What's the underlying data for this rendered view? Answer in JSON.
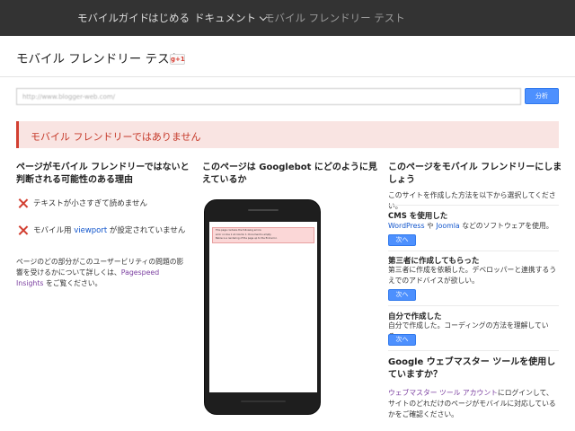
{
  "nav": {
    "items": [
      "モバイルガイド",
      "はじめる",
      "ドキュメント"
    ],
    "current": "モバイル フレンドリー テスト"
  },
  "header": {
    "title": "モバイル フレンドリー テスト",
    "gplus": "g+1"
  },
  "search": {
    "url_value": "http://www.blogger-web.com/",
    "button": "分析"
  },
  "result": {
    "message": "モバイル フレンドリーではありません"
  },
  "col1": {
    "heading": "ページがモバイル フレンドリーではないと判断される可能性のある理由",
    "issue1": "テキストが小さすぎて読めません",
    "issue2_prefix": "モバイル用 ",
    "issue2_link": "viewport",
    "issue2_suffix": " が設定されていません",
    "footer_prefix": "ページのどの部分がこのユーザービリティの問題の影響を受けるかについて詳しくは、",
    "footer_link": "Pagespeed Insights",
    "footer_suffix": " をご覧ください。"
  },
  "col2": {
    "heading_prefix": "このページは ",
    "heading_strong": "Googlebot",
    "heading_suffix": " にどのように見えているか",
    "screen_line1": "This page contains the following errors:",
    "screen_line2": "error on line 1 at column 1: Document is empty",
    "screen_line3": "Below is a rendering of the page up to the first error."
  },
  "col3": {
    "heading": "このページをモバイル フレンドリーにしましょう",
    "intro": "このサイトを作成した方法を以下から選択してください。",
    "cms_title": "CMS を使用した",
    "cms_link1": "WordPress",
    "cms_mid": " や ",
    "cms_link2": "Joomla",
    "cms_suffix": " などのソフトウェアを使用。",
    "next1": "次へ",
    "third_title": "第三者に作成してもらった",
    "third_desc": "第三者に作成を依頼した。デベロッパーと連携するうえでのアドバイスが欲しい。",
    "next2": "次へ",
    "self_title": "自分で作成した",
    "self_desc": "自分で作成した。コーディングの方法を理解している。",
    "next3": "次へ",
    "wmt_heading": "Google ウェブマスター ツールを使用していますか？",
    "wmt_link": "ウェブマスター ツール アカウント",
    "wmt_suffix": "にログインして、サイトのどれだけのページがモバイルに対応しているかをご確認ください。"
  },
  "colors": {
    "nav_bg": "#333333",
    "error_red": "#d23f31",
    "banner_bg": "#f9e4e2",
    "button_blue": "#4d90fe",
    "link_blue": "#1155cc"
  }
}
